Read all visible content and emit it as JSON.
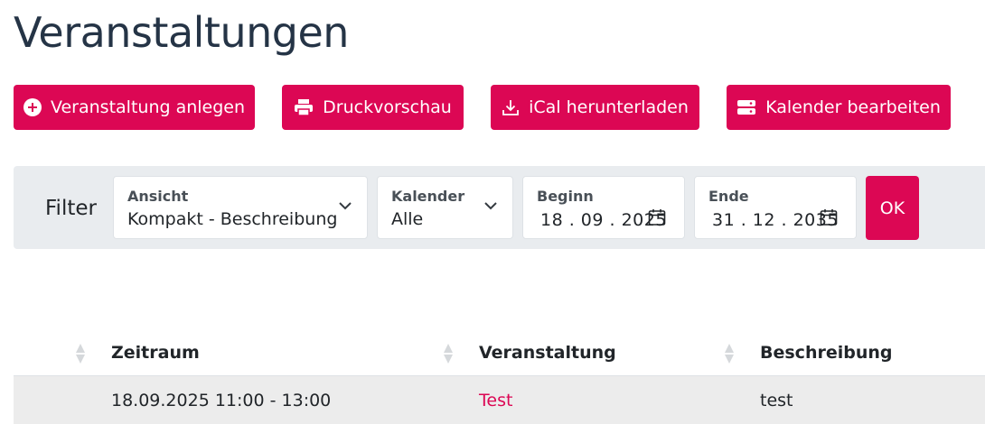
{
  "page": {
    "title": "Veranstaltungen"
  },
  "actions": {
    "add_label": "Veranstaltung anlegen",
    "print_label": "Druckvorschau",
    "ical_label": "iCal herunterladen",
    "calendar_label": "Kalender bearbeiten"
  },
  "filter": {
    "label": "Filter",
    "ansicht": {
      "label": "Ansicht",
      "value": "Kompakt - Beschreibung"
    },
    "kalender": {
      "label": "Kalender",
      "value": "Alle"
    },
    "beginn": {
      "label": "Beginn",
      "value": "18 . 09 . 2025"
    },
    "ende": {
      "label": "Ende",
      "value": "31 . 12 . 2035"
    },
    "ok_label": "OK"
  },
  "table": {
    "columns": [
      "Zeitraum",
      "Veranstaltung",
      "Beschreibung"
    ],
    "rows": [
      {
        "zeitraum": "18.09.2025 11:00 - 13:00",
        "veranstaltung": "Test",
        "beschreibung": "test"
      }
    ]
  },
  "colors": {
    "accent": "#dc0754",
    "title": "#253446",
    "filter_bg": "#e9ecef",
    "row_bg": "#ececec"
  }
}
